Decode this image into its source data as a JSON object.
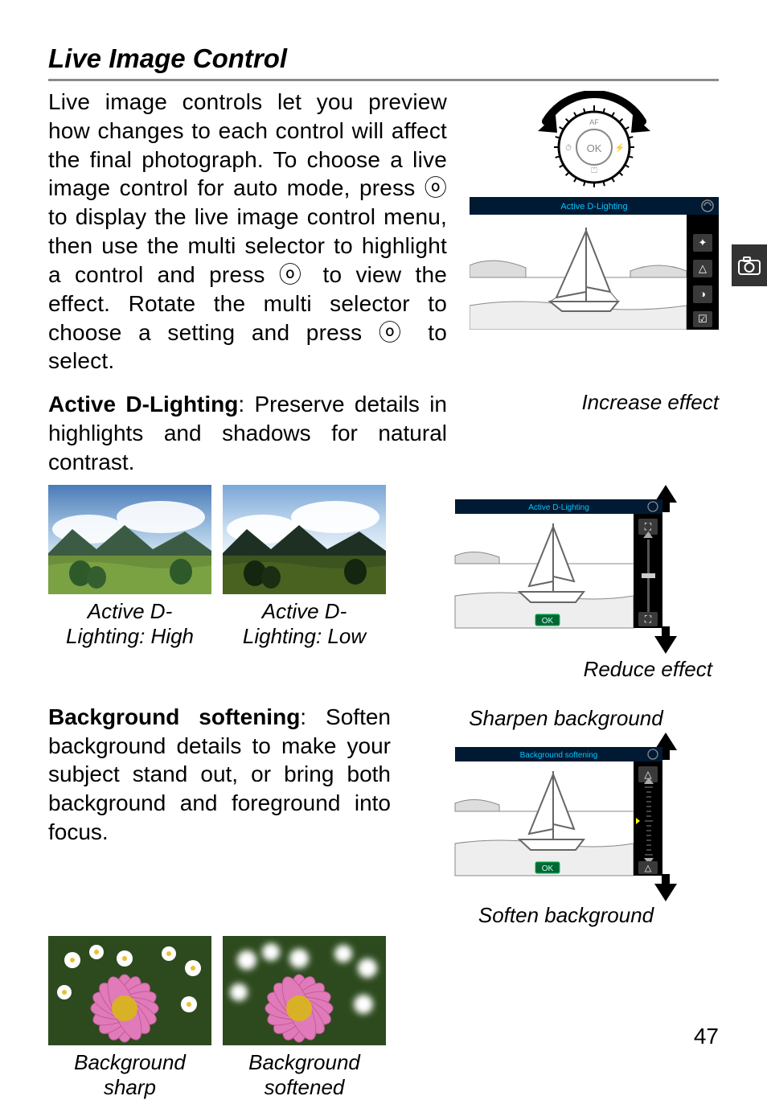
{
  "heading": "Live Image Control",
  "intro": "Live image controls let you preview how changes to each control will affect the final photograph. To choose a live image control for auto mode, press ⓞ to display the live image control menu, then use the multi selector to highlight a control and press ⓞ to view the effect. Rotate the multi selector to choose a setting and press ⓞ to select.",
  "preview1": {
    "title": "Active D-Lighting"
  },
  "adl": {
    "label": "Active D-Lighting",
    "desc": ": Preserve details in highlights and shadows for natural contrast.",
    "increase": "Increase effect",
    "reduce": "Reduce effect",
    "capHigh": "Active D-Lighting: High",
    "capLow": "Active D-Lighting: Low",
    "screenTitle": "Active D-Lighting",
    "ok": "OK"
  },
  "bg": {
    "label": "Background softening",
    "desc": ": Soften background details to make your subject stand out, or bring both background and foreground into focus.",
    "sharpen": "Sharpen background",
    "soften": "Soften background",
    "capSharp": "Background sharp",
    "capSoft": "Background softened",
    "screenTitle": "Background softening",
    "ok": "OK"
  },
  "pageNumber": "47"
}
